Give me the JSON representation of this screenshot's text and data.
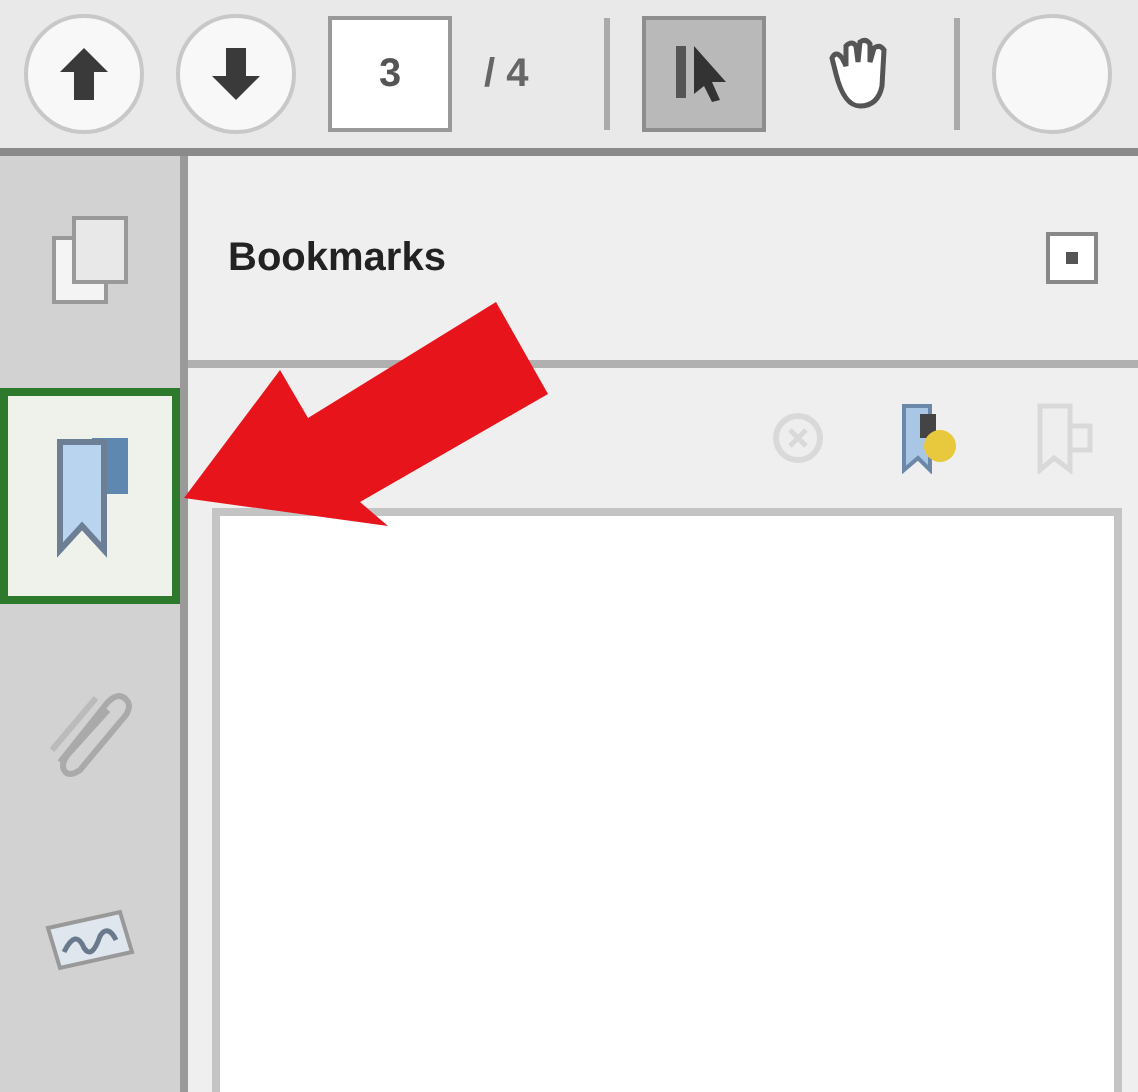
{
  "toolbar": {
    "page_field": {
      "value": "3"
    },
    "page_count": "/ 4",
    "tools": [
      {
        "kind": "select",
        "selected": true
      },
      {
        "kind": "hand",
        "selected": false
      }
    ]
  },
  "sidebar": {
    "tabs": [
      {
        "kind": "pages",
        "selected": false
      },
      {
        "kind": "bookmarks",
        "selected": true
      },
      {
        "kind": "attachments",
        "selected": false
      },
      {
        "kind": "signatures",
        "selected": false
      }
    ]
  },
  "panel": {
    "title": "Bookmarks",
    "actions": [
      {
        "kind": "delete",
        "disabled": true
      },
      {
        "kind": "new",
        "disabled": false
      },
      {
        "kind": "options",
        "disabled": true
      }
    ]
  }
}
